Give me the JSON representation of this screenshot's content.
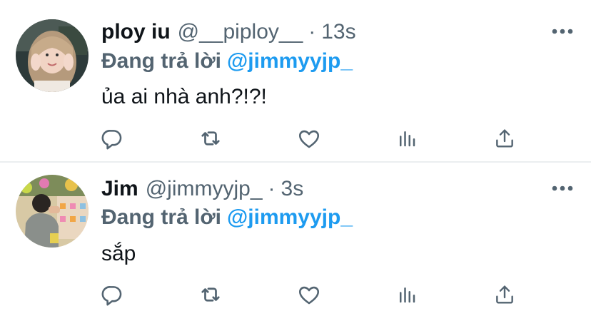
{
  "colors": {
    "text_primary": "#0f1419",
    "text_secondary": "#536471",
    "accent": "#1d9bf0",
    "divider": "#ebeef0"
  },
  "tweets": [
    {
      "name": "ploy iu",
      "handle": "@__piploy__",
      "separator": "·",
      "time": "13s",
      "reply_label": "Đang trả lời",
      "reply_to": "@jimmyyjp_",
      "text": "ủa ai nhà anh?!?!",
      "avatar_icon": "profile-photo-girl"
    },
    {
      "name": "Jim",
      "handle": "@jimmyyjp_",
      "separator": "·",
      "time": "3s",
      "reply_label": "Đang trả lời",
      "reply_to": "@jimmyyjp_",
      "text": "sắp",
      "avatar_icon": "profile-photo-arcade"
    }
  ],
  "action_icons": [
    "reply-icon",
    "retweet-icon",
    "like-icon",
    "analytics-icon",
    "share-icon"
  ]
}
